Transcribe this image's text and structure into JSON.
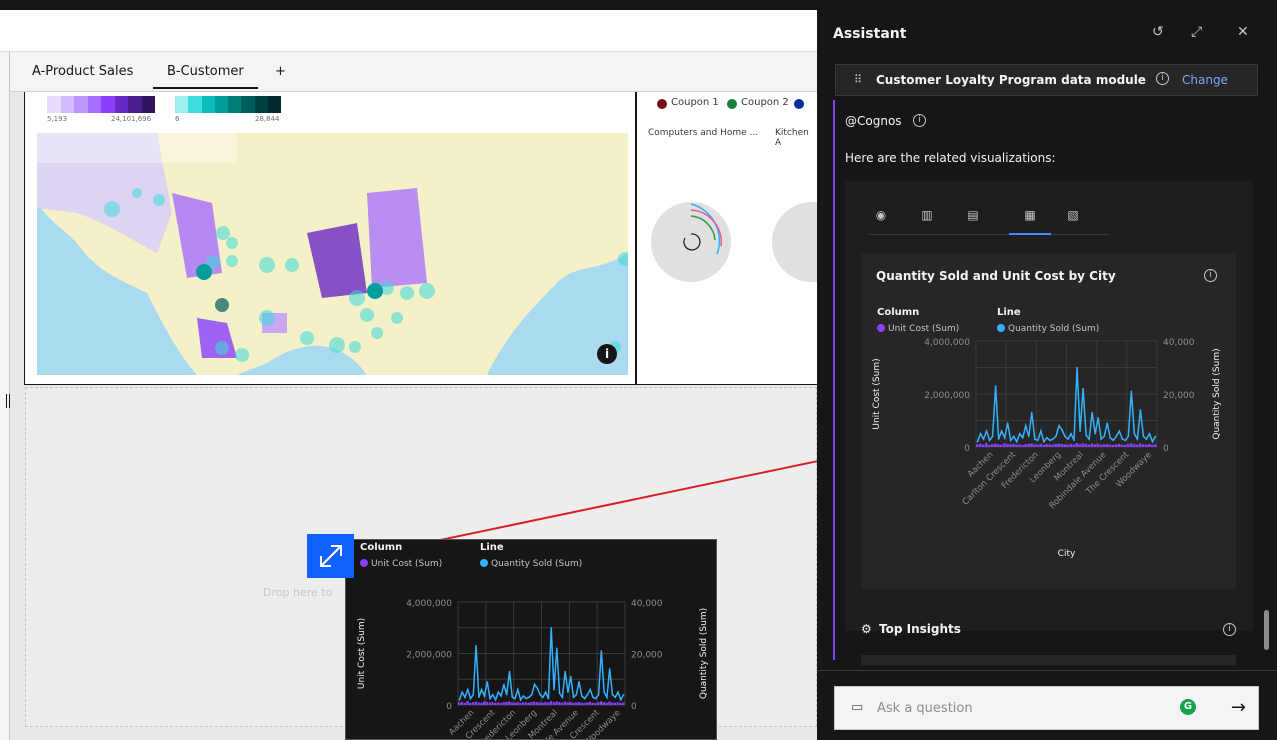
{
  "tabs": [
    "A-Product Sales",
    "B-Customer",
    "+"
  ],
  "map_legend": {
    "scale1_min": "5,193",
    "scale1_max": "24,101,696",
    "scale2_min": "6",
    "scale2_max": "28,844"
  },
  "radial": {
    "legend": [
      "Coupon 1",
      "Coupon 2"
    ],
    "categories": [
      "Computers and Home ...",
      "Kitchen A"
    ]
  },
  "dropzone_text": "Drop here to",
  "panel": {
    "title": "Assistant",
    "module": "Customer Loyalty Program data module",
    "change": "Change",
    "mention": "@Cognos",
    "related": "Here are the related visualizations:",
    "ask_placeholder": "Ask a question",
    "top_insights": "Top Insights"
  },
  "chart_data": {
    "type": "bar",
    "title": "Quantity Sold and Unit Cost by City",
    "legend_groups": [
      {
        "heading": "Column",
        "series": "Unit Cost (Sum)",
        "color": "#8a3ffc"
      },
      {
        "heading": "Line",
        "series": "Quantity Sold (Sum)",
        "color": "#33b1ff"
      }
    ],
    "xlabel": "City",
    "ylabel_left": "Unit Cost (Sum)",
    "ylabel_right": "Quantity Sold (Sum)",
    "y_left_ticks": [
      "4,000,000",
      "2,000,000",
      "0"
    ],
    "y_right_ticks": [
      "40,000",
      "20,000",
      "0"
    ],
    "x_tick_labels": [
      "Aachen",
      "Carlton Crescent",
      "Fredericton",
      "Leonberg",
      "Montreal",
      "Robindale Avenue",
      "The Crescent",
      "Woodwaye"
    ],
    "ylim_left": [
      0,
      4000000
    ],
    "ylim_right": [
      0,
      40000
    ],
    "line_values": [
      2000,
      5000,
      3000,
      6000,
      2500,
      4000,
      23000,
      3000,
      6000,
      3500,
      9000,
      2500,
      4000,
      2000,
      5000,
      3500,
      8000,
      4000,
      13000,
      3000,
      2500,
      6000,
      2000,
      3500,
      2500,
      3000,
      4000,
      8000,
      6500,
      4000,
      3000,
      5000,
      2500,
      30000,
      6000,
      22000,
      4500,
      3000,
      13000,
      5000,
      11000,
      3000,
      4000,
      9000,
      3500,
      2500,
      4000,
      6000,
      3000,
      2500,
      4000,
      21000,
      5000,
      3000,
      14000,
      4000,
      3000,
      5000,
      2000,
      4000
    ],
    "column_values": [
      100000,
      120000,
      90000,
      150000,
      80000,
      110000,
      130000,
      100000,
      90000,
      140000,
      110000,
      100000,
      120000,
      90000,
      100000,
      80000,
      110000,
      120000,
      140000,
      100000,
      90000,
      120000,
      80000,
      110000,
      100000,
      90000,
      120000,
      130000,
      110000,
      100000,
      90000,
      120000,
      100000,
      150000,
      110000,
      140000,
      120000,
      90000,
      130000,
      100000,
      120000,
      90000,
      100000,
      110000,
      90000,
      80000,
      100000,
      120000,
      90000,
      80000,
      110000,
      140000,
      110000,
      90000,
      130000,
      100000,
      90000,
      110000,
      80000,
      100000
    ]
  }
}
